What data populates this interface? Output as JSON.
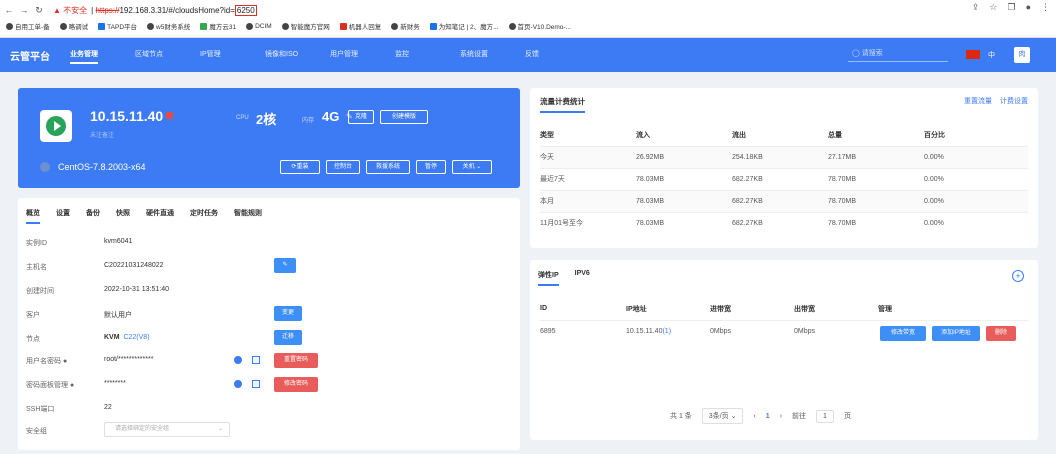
{
  "browser": {
    "warning": "不安全",
    "url_https": "https://",
    "url_rest": "192.168.3.31/#/cloudsHome?id=",
    "url_id": "6250",
    "bookmarks": [
      {
        "label": "自用工单-备"
      },
      {
        "label": "略调试"
      },
      {
        "label": "TAPD平台"
      },
      {
        "label": "w5财务系统"
      },
      {
        "label": "魔方云31"
      },
      {
        "label": "DCIM"
      },
      {
        "label": "智能魔方官网"
      },
      {
        "label": "机器人回复"
      },
      {
        "label": "新财务"
      },
      {
        "label": "为知笔记 | 2、魔方..."
      },
      {
        "label": "首页-V10.Demo-..."
      }
    ]
  },
  "topnav": {
    "brand": "云管平台",
    "menu": [
      "业务管理",
      "区域节点",
      "IP管理",
      "镜像和ISO",
      "用户管理",
      "监控",
      "系统设置",
      "反馈"
    ],
    "search_placeholder": "请搜索",
    "lang": "中",
    "avatar": "肉"
  },
  "instance": {
    "ip": "10.15.11.40",
    "note": "未注备注",
    "cpu_label": "CPU",
    "cpu_value": "2核",
    "mem_label": "内存",
    "mem_value": "4G",
    "btn_clone": "克隆",
    "btn_template": "创建模版",
    "os": "CentOS-7.8.2003-x64",
    "actions": [
      "⟳重装",
      "控制台",
      "救援系统",
      "暂停",
      "关机 ⌄"
    ]
  },
  "details": {
    "tabs": [
      "概览",
      "设置",
      "备份",
      "快照",
      "硬件直通",
      "定时任务",
      "智能规则"
    ],
    "rows": {
      "instance_id_label": "实例ID",
      "instance_id": "kvm6041",
      "hostname_label": "主机名",
      "hostname": "C20221031248022",
      "created_label": "创建时间",
      "created": "2022-10-31 13:51:40",
      "customer_label": "客户",
      "customer": "默认用户",
      "node_label": "节点",
      "node_type": "KVM",
      "node": "C22(V8)",
      "user_pwd_label": "用户名密码",
      "user_pwd": "root/*************",
      "panel_pwd_label": "密码面板管理",
      "panel_pwd": "********",
      "ssh_label": "SSH端口",
      "ssh": "22",
      "sg_label": "安全组",
      "sg_placeholder": "请选择绑定的安全组"
    },
    "btn_change": "变更",
    "btn_migrate": "迁移",
    "btn_reset_pwd": "重置密码",
    "btn_modify_pwd": "修改密码"
  },
  "traffic": {
    "title": "流量计费统计",
    "link_reset": "重置流量",
    "link_setting": "计费设置",
    "headers": [
      "类型",
      "流入",
      "流出",
      "总量",
      "百分比"
    ],
    "rows": [
      [
        "今天",
        "26.92MB",
        "254.18KB",
        "27.17MB",
        "0.00%"
      ],
      [
        "最近7天",
        "78.03MB",
        "682.27KB",
        "78.70MB",
        "0.00%"
      ],
      [
        "本月",
        "78.03MB",
        "682.27KB",
        "78.70MB",
        "0.00%"
      ],
      [
        "11月01号至今",
        "78.03MB",
        "682.27KB",
        "78.70MB",
        "0.00%"
      ]
    ]
  },
  "ip_panel": {
    "tabs": [
      "弹性IP",
      "IPV6"
    ],
    "headers": [
      "ID",
      "IP地址",
      "进带宽",
      "出带宽",
      "管理"
    ],
    "row": {
      "id": "6895",
      "ip": "10.15.11.40",
      "ip_count": "(1)",
      "in": "0Mbps",
      "out": "0Mbps"
    },
    "btn_bw": "修改带宽",
    "btn_add": "添加IP地址",
    "btn_del": "删除",
    "pager": {
      "total": "共 1 条",
      "size": "3条/页",
      "page": "1",
      "goto": "前往",
      "goto_val": "1",
      "unit": "页"
    }
  }
}
